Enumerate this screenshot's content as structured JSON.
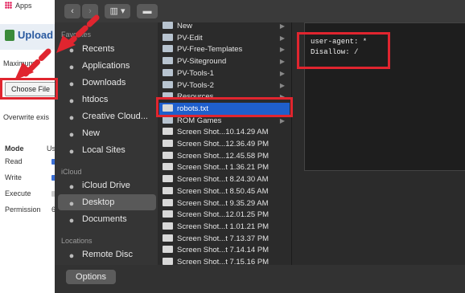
{
  "browser": {
    "apps_label": "Apps"
  },
  "page": {
    "upload_title": "Upload",
    "max_label": "Maximum",
    "choose_file_label": "Choose File",
    "overwrite_label": "Overwrite exis",
    "mode_label": "Mode",
    "mode_value": "Us",
    "read_label": "Read",
    "write_label": "Write",
    "execute_label": "Execute",
    "permission_label": "Permission",
    "permission_value": "6"
  },
  "dialog": {
    "options_button": "Options",
    "sidebar": {
      "favorites_header": "Favorites",
      "favorites": [
        {
          "label": "Recents",
          "icon": "clock-icon"
        },
        {
          "label": "Applications",
          "icon": "applications-icon"
        },
        {
          "label": "Downloads",
          "icon": "download-icon"
        },
        {
          "label": "htdocs",
          "icon": "folder-icon"
        },
        {
          "label": "Creative Cloud...",
          "icon": "creative-cloud-icon"
        },
        {
          "label": "New",
          "icon": "folder-icon"
        },
        {
          "label": "Local Sites",
          "icon": "folder-icon"
        }
      ],
      "icloud_header": "iCloud",
      "icloud": [
        {
          "label": "iCloud Drive",
          "icon": "cloud-icon"
        },
        {
          "label": "Desktop",
          "icon": "desktop-icon",
          "selected": true
        },
        {
          "label": "Documents",
          "icon": "document-icon"
        }
      ],
      "locations_header": "Locations",
      "locations": [
        {
          "label": "Remote Disc",
          "icon": "disc-icon"
        }
      ]
    },
    "files": [
      {
        "name": "New",
        "folder": true
      },
      {
        "name": "PV-Edit",
        "folder": true
      },
      {
        "name": "PV-Free-Templates",
        "folder": true
      },
      {
        "name": "PV-Siteground",
        "folder": true
      },
      {
        "name": "PV-Tools-1",
        "folder": true
      },
      {
        "name": "PV-Tools-2",
        "folder": true
      },
      {
        "name": "Resources",
        "folder": true
      },
      {
        "name": "robots.txt",
        "folder": false,
        "selected": true
      },
      {
        "name": "ROM Games",
        "folder": true
      },
      {
        "name": "Screen Shot...10.14.29 AM",
        "folder": false
      },
      {
        "name": "Screen Shot...12.36.49 PM",
        "folder": false
      },
      {
        "name": "Screen Shot...12.45.58 PM",
        "folder": false
      },
      {
        "name": "Screen Shot...t 1.36.21 PM",
        "folder": false
      },
      {
        "name": "Screen Shot...t 8.24.30 AM",
        "folder": false
      },
      {
        "name": "Screen Shot...t 8.50.45 AM",
        "folder": false
      },
      {
        "name": "Screen Shot...t 9.35.29 AM",
        "folder": false
      },
      {
        "name": "Screen Shot...12.01.25 PM",
        "folder": false
      },
      {
        "name": "Screen Shot...t 1.01.21 PM",
        "folder": false
      },
      {
        "name": "Screen Shot...t 7.13.37 PM",
        "folder": false
      },
      {
        "name": "Screen Shot...t 7.14.14 PM",
        "folder": false
      },
      {
        "name": "Screen Shot...t 7.15.16 PM",
        "folder": false
      }
    ],
    "preview_text": "user-agent: *\nDisallow: /"
  },
  "colors": {
    "highlight": "#e0252f",
    "selection": "#1f5fcc"
  }
}
